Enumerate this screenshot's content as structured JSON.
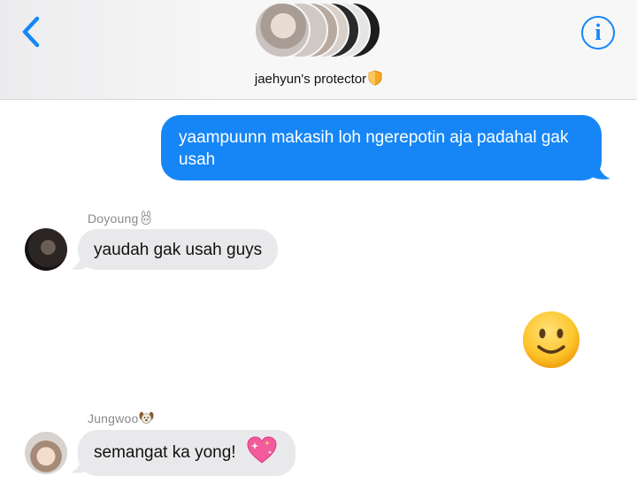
{
  "header": {
    "group_name": "jaehyun's protector",
    "back_icon": "chevron-left-icon",
    "info_icon": "info-icon",
    "accent": "#1686f7"
  },
  "messages": [
    {
      "direction": "outgoing",
      "text": "yaampuunn makasih loh ngerepotin aja padahal gak usah"
    },
    {
      "direction": "incoming",
      "sender": "Doyoung",
      "sender_emoji": "rabbit-emoji",
      "text": "yaudah gak usah guys"
    },
    {
      "direction": "incoming",
      "sender": "",
      "text": "",
      "emoji": "slightly-smiling-face"
    },
    {
      "direction": "incoming",
      "sender": "Jungwoo",
      "sender_emoji": "dog-emoji",
      "text": "semangat ka yong!",
      "trailing_emoji": "sparkling-heart"
    }
  ],
  "colors": {
    "outgoing_bubble": "#1686f7",
    "incoming_bubble": "#e9e9eb",
    "sender_name": "#8a8a8e"
  }
}
